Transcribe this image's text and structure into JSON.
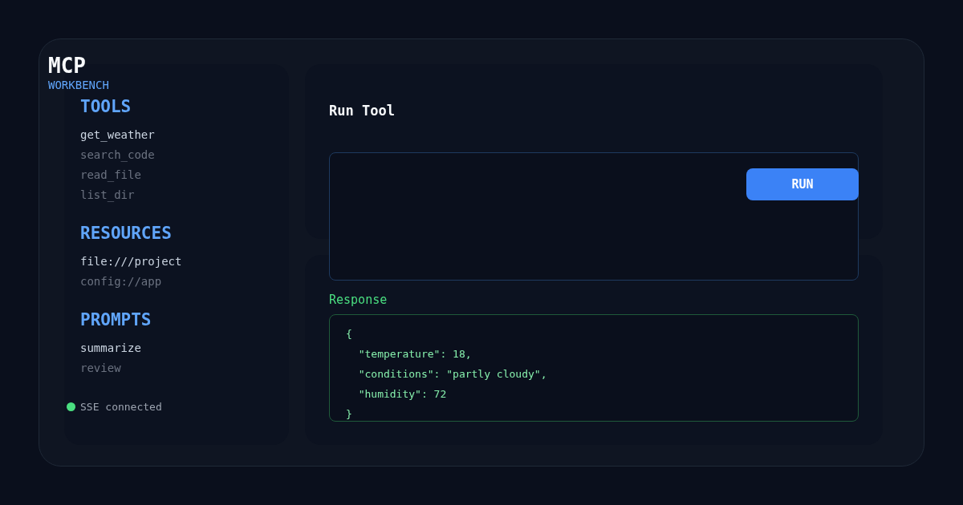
{
  "brand": {
    "title": "MCP",
    "subtitle": "WORKBENCH"
  },
  "sidebar": {
    "sections": [
      {
        "heading": "TOOLS",
        "items": [
          {
            "label": "get_weather",
            "selected": true
          },
          {
            "label": "search_code",
            "selected": false
          },
          {
            "label": "read_file",
            "selected": false
          },
          {
            "label": "list_dir",
            "selected": false
          }
        ]
      },
      {
        "heading": "RESOURCES",
        "items": [
          {
            "label": "file:///project",
            "selected": true
          },
          {
            "label": "config://app",
            "selected": false
          }
        ]
      },
      {
        "heading": "PROMPTS",
        "items": [
          {
            "label": "summarize",
            "selected": true
          },
          {
            "label": "review",
            "selected": false
          }
        ]
      }
    ],
    "status": {
      "label": "SSE connected",
      "color": "#4ade80"
    }
  },
  "run_panel": {
    "title": "Run Tool",
    "button": "RUN"
  },
  "response": {
    "label": "Response",
    "lines": [
      "{",
      "  \"temperature\": 18,",
      "  \"conditions\": \"partly cloudy\",",
      "  \"humidity\": 72",
      "}"
    ]
  }
}
